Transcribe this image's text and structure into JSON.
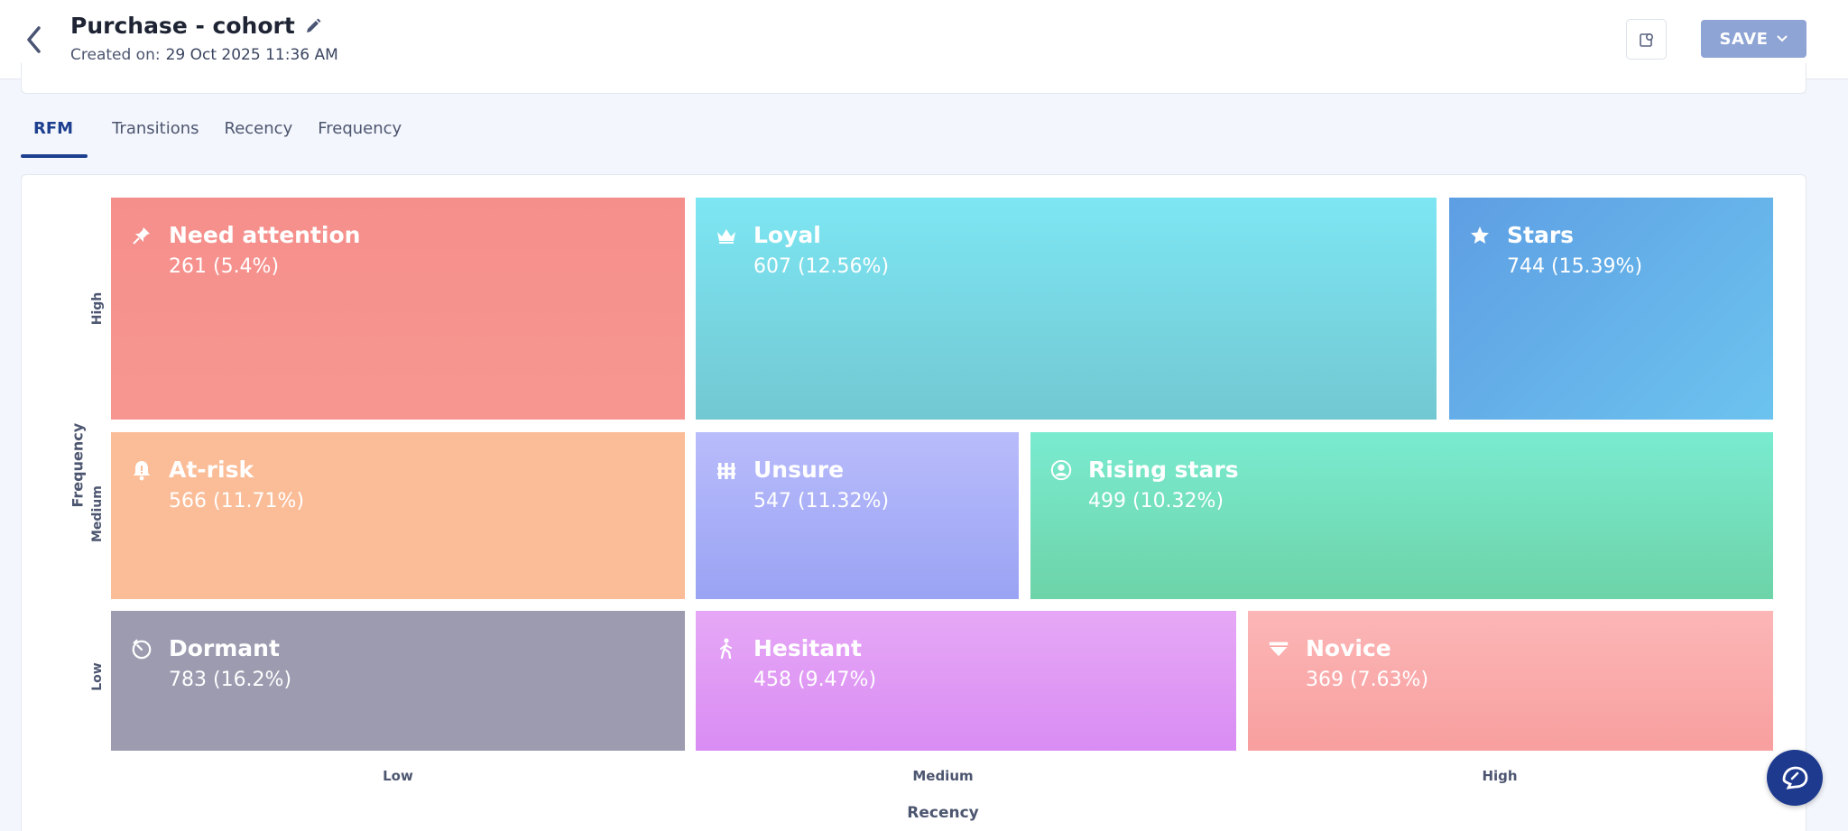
{
  "header": {
    "title": "Purchase - cohort",
    "created_label": "Created on:",
    "created_date": "29 Oct 2025 11:36 AM",
    "save_label": "SAVE"
  },
  "tabs": [
    {
      "label": "RFM",
      "active": true
    },
    {
      "label": "Transitions",
      "active": false
    },
    {
      "label": "Recency",
      "active": false
    },
    {
      "label": "Frequency",
      "active": false
    }
  ],
  "chart": {
    "x_axis_title": "Recency",
    "y_axis_title": "Frequency",
    "x_ticks": [
      "Low",
      "Medium",
      "High"
    ],
    "y_ticks": [
      "High",
      "Medium",
      "Low"
    ]
  },
  "chart_data": {
    "type": "heatmap",
    "x_axis": "Recency",
    "y_axis": "Frequency",
    "segments": [
      {
        "name": "Need attention",
        "value": "261 (5.4%)",
        "count": 261,
        "percent": 5.4,
        "frequency": "High",
        "recency": "Low",
        "color": "#f58f8c",
        "icon": "pin-icon"
      },
      {
        "name": "Loyal",
        "value": "607 (12.56%)",
        "count": 607,
        "percent": 12.56,
        "frequency": "High",
        "recency": "Medium",
        "color": "#7ae3f0",
        "icon": "crown-icon"
      },
      {
        "name": "Stars",
        "value": "744 (15.39%)",
        "count": 744,
        "percent": 15.39,
        "frequency": "High",
        "recency": "High",
        "color": "#62aee8",
        "icon": "star-icon"
      },
      {
        "name": "At-risk",
        "value": "566 (11.71%)",
        "count": 566,
        "percent": 11.71,
        "frequency": "Medium",
        "recency": "Low",
        "color": "#fbbd98",
        "icon": "bell-icon"
      },
      {
        "name": "Unsure",
        "value": "547 (11.32%)",
        "count": 547,
        "percent": 11.32,
        "frequency": "Medium",
        "recency": "Medium",
        "color": "#aab0f8",
        "icon": "fence-icon"
      },
      {
        "name": "Rising stars",
        "value": "499 (10.32%)",
        "count": 499,
        "percent": 10.32,
        "frequency": "Medium",
        "recency": "High",
        "color": "#74e2c4",
        "icon": "user-circle-icon"
      },
      {
        "name": "Dormant",
        "value": "783 (16.2%)",
        "count": 783,
        "percent": 16.2,
        "frequency": "Low",
        "recency": "Low",
        "color": "#9c9bb0",
        "icon": "timer-icon"
      },
      {
        "name": "Hesitant",
        "value": "458 (9.47%)",
        "count": 458,
        "percent": 9.47,
        "frequency": "Low",
        "recency": "Medium",
        "color": "#e59cf4",
        "icon": "walker-icon"
      },
      {
        "name": "Novice",
        "value": "369 (7.63%)",
        "count": 369,
        "percent": 7.63,
        "frequency": "Low",
        "recency": "High",
        "color": "#fba3a3",
        "icon": "gem-icon"
      }
    ]
  }
}
